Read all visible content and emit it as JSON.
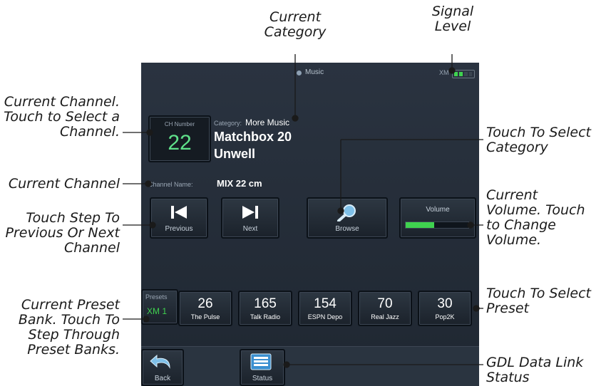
{
  "annotations": {
    "current_category": [
      "Current",
      "Category"
    ],
    "signal_level": [
      "Signal",
      "Level"
    ],
    "current_channel_select": [
      "Current Channel.",
      "Touch to Select a",
      "Channel."
    ],
    "touch_select_category": [
      "Touch To Select",
      "Category"
    ],
    "current_channel": [
      "Current Channel"
    ],
    "current_volume": [
      "Current",
      "Volume. Touch",
      "to Change",
      "Volume."
    ],
    "step_channel": [
      "Touch Step To",
      "Previous Or Next",
      "Channel"
    ],
    "preset_bank": [
      "Current Preset",
      "Bank. Touch To",
      "Step Through",
      "Preset Banks."
    ],
    "touch_select_preset": [
      "Touch To Select",
      "Preset"
    ],
    "gdl_status": [
      "GDL Data Link",
      "Status"
    ]
  },
  "screen": {
    "title": "Music",
    "signal": {
      "label": "XM",
      "bars_filled": 2,
      "bars_total": 4
    },
    "channel_button": {
      "label": "CH Number",
      "number": "22"
    },
    "category_label": "Category:",
    "category_value": "More Music",
    "artist": "Matchbox 20",
    "song": "Unwell",
    "channel_name_label": "Channel Name:",
    "channel_name": "MIX 22 cm",
    "controls": {
      "previous": "Previous",
      "next": "Next",
      "browse": "Browse",
      "volume": "Volume",
      "volume_level": 0.45
    },
    "presets_bank": {
      "label": "Presets",
      "bank": "XM 1"
    },
    "presets": [
      {
        "number": "26",
        "name": "The Pulse"
      },
      {
        "number": "165",
        "name": "Talk Radio"
      },
      {
        "number": "154",
        "name": "ESPN Depo"
      },
      {
        "number": "70",
        "name": "Real Jazz"
      },
      {
        "number": "30",
        "name": "Pop2K"
      }
    ],
    "back": "Back",
    "status": "Status"
  },
  "colors": {
    "accent_green": "#3fd24f",
    "button_bg": "#222a33",
    "screen_bg": "#232c37"
  }
}
